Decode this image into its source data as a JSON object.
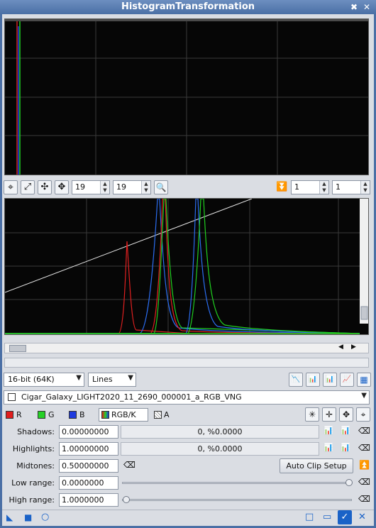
{
  "window": {
    "title": "HistogramTransformation"
  },
  "colors": {
    "titlebar": "#4a6fa5",
    "red": "#e11d1d",
    "green": "#26d126",
    "blue": "#1f3bdf",
    "accent": "#1a62c7"
  },
  "toolbar": {
    "zoom_x": "19",
    "zoom_y": "19",
    "range_a": "1",
    "range_b": "1",
    "icons": [
      "target-icon",
      "zoom-fit-icon",
      "expand-icon",
      "pan-icon",
      "magnifier-icon",
      "double-chevron-down-icon"
    ]
  },
  "display": {
    "resolution": "16-bit (64K)",
    "graph_style": "Lines",
    "view": "Cigar_Galaxy_LIGHT2020_11_2690_000001_a_RGB_VNG"
  },
  "channels": {
    "r": "R",
    "g": "G",
    "b": "B",
    "rgbk": "RGB/K",
    "a": "A"
  },
  "params": {
    "shadows_label": "Shadows:",
    "shadows_value": "0.00000000",
    "shadows_clip": "0, %0.0000",
    "highlights_label": "Highlights:",
    "highlights_value": "1.00000000",
    "highlights_clip": "0, %0.0000",
    "midtones_label": "Midtones:",
    "midtones_value": "0.50000000",
    "low_range_label": "Low range:",
    "low_range_value": "0.0000000",
    "high_range_label": "High range:",
    "high_range_value": "1.0000000",
    "auto_clip": "Auto Clip Setup"
  }
}
